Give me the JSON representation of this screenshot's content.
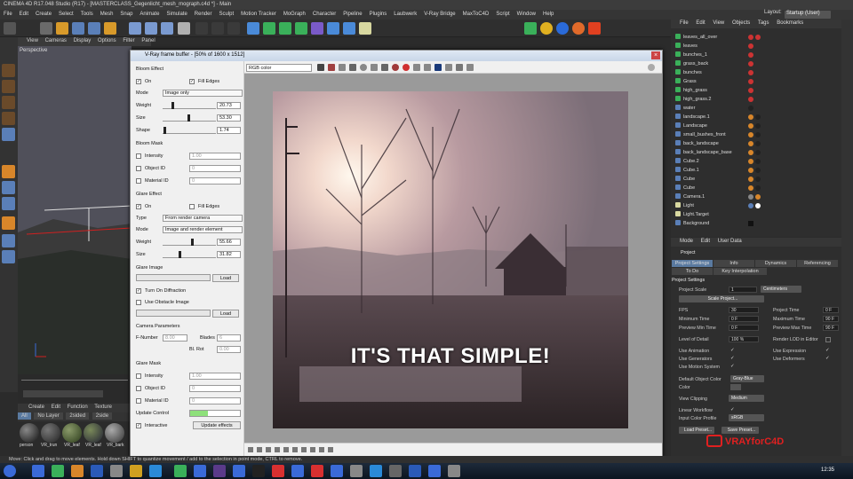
{
  "titlebar": "CINEMA 4D R17.048 Studio (R17) - [MASTERCLASS_Gegenlicht_mesh_mograph.c4d *] - Main",
  "menu": [
    "File",
    "Edit",
    "Create",
    "Select",
    "Tools",
    "Mesh",
    "Snap",
    "Animate",
    "Simulate",
    "Render",
    "Sculpt",
    "Motion Tracker",
    "MoGraph",
    "Character",
    "Pipeline",
    "Plugins",
    "Laubwerk",
    "V-Ray Bridge",
    "MaxToC4D",
    "Script",
    "Window",
    "Help"
  ],
  "layout": {
    "label": "Layout:",
    "value": "Startup (User)"
  },
  "viewport": {
    "menu": [
      "View",
      "Cameras",
      "Display",
      "Options",
      "Filter",
      "Panel"
    ],
    "label": "Perspective"
  },
  "material_manager": {
    "menu": [
      "Create",
      "Edit",
      "Function",
      "Texture"
    ],
    "tabs": [
      "All",
      "No Layer",
      "2sided",
      "2side"
    ],
    "materials": [
      "person",
      "VR_trun",
      "VR_leaf",
      "VR_leaf",
      "VR_bark"
    ]
  },
  "vfb": {
    "title": "V-Ray frame buffer - [50% of 1600 x 1512]",
    "channel": "RGB color",
    "bloom_effect": {
      "header": "Bloom Effect",
      "on": "On",
      "fill_edges": "Fill Edges",
      "mode_label": "Mode",
      "mode": "Image only",
      "weight_label": "Weight",
      "weight": "20.73",
      "size_label": "Size",
      "size": "53.30",
      "shape_label": "Shape",
      "shape": "1.74"
    },
    "bloom_mask": {
      "header": "Bloom Mask",
      "intensity": "Intensity",
      "intensity_val": "1.00",
      "object_id": "Object ID",
      "object_id_val": "0",
      "material_id": "Material ID",
      "material_id_val": "0"
    },
    "glare_effect": {
      "header": "Glare Effect",
      "on": "On",
      "fill_edges": "Fill Edges",
      "type_label": "Type",
      "type": "From render camera",
      "mode_label": "Mode",
      "mode": "Image and render element",
      "weight_label": "Weight",
      "weight": "55.66",
      "size_label": "Size",
      "size": "31.82"
    },
    "glare_image": {
      "header": "Glare Image",
      "load": "Load",
      "diffraction": "Turn On Diffraction",
      "obstacle": "Use Obstacle Image",
      "load2": "Load"
    },
    "camera": {
      "header": "Camera Parameters",
      "fnumber": "F-Number",
      "fnumber_val": "8.00",
      "blades": "Blades",
      "blades_val": "6",
      "blrot": "Bl. Rot",
      "blrot_val": "0.00"
    },
    "glare_mask": {
      "header": "Glare Mask",
      "intensity": "Intensity",
      "intensity_val": "1.00",
      "object_id": "Object ID",
      "object_id_val": "0",
      "material_id": "Material ID",
      "material_id_val": "0"
    },
    "update_control": "Update Control",
    "interactive": "Interactive",
    "update_effects": "Update effects",
    "caption": "IT'S THAT SIMPLE!"
  },
  "object_manager": {
    "menu": [
      "File",
      "Edit",
      "View",
      "Objects",
      "Tags",
      "Bookmarks"
    ],
    "objects": [
      "leaves_all_over",
      "leaves",
      "bunches_1",
      "grass_back",
      "bunches",
      "Grass",
      "high_grass",
      "high_grass.2",
      "water",
      "landscape.1",
      "Landscape",
      "small_bushes_front",
      "back_landscape",
      "back_landscape_base",
      "Cube.2",
      "Cube.1",
      "Cube",
      "Cube",
      "Camera.1",
      "Light",
      "Light.Target",
      "Background"
    ]
  },
  "attributes": {
    "menu": [
      "Mode",
      "Edit",
      "User Data"
    ],
    "object": "Project",
    "tabs": [
      "Project Settings",
      "Info",
      "Dynamics",
      "Referencing",
      "To Do",
      "Key Interpolation"
    ],
    "section": "Project Settings",
    "project_scale": "Project Scale",
    "project_scale_val": "1",
    "project_scale_unit": "Centimeters",
    "scale_project": "Scale Project...",
    "fps": "FPS",
    "fps_val": "30",
    "project_time": "Project Time",
    "project_time_val": "0 F",
    "min_time": "Minimum Time",
    "min_time_val": "0 F",
    "max_time": "Maximum Time",
    "max_time_val": "90 F",
    "prev_min": "Preview Min Time",
    "prev_min_val": "0 F",
    "prev_max": "Preview Max Time",
    "prev_max_val": "90 F",
    "lod": "Level of Detail",
    "lod_val": "100 %",
    "render_lod": "Render LOD in Editor",
    "use_anim": "Use Animation",
    "use_expr": "Use Expression",
    "use_gen": "Use Generators",
    "use_deform": "Use Deformers",
    "use_motion": "Use Motion System",
    "default_color": "Default Object Color",
    "default_color_val": "Gray-Blue",
    "color": "Color",
    "view_clipping": "View Clipping",
    "view_clipping_val": "Medium",
    "linear_workflow": "Linear Workflow",
    "input_color": "Input Color Profile",
    "input_color_val": "sRGB",
    "load_preset": "Load Preset...",
    "save_preset": "Save Preset..."
  },
  "brand": "VRAYforC4D",
  "status": "Move: Click and drag to move elements. Hold down SHIFT to quantize movement / add to the selection in point mode, CTRL to remove.",
  "clock": "12:35",
  "colors": {
    "accent": "#e02020",
    "selected_tab": "#5a7aa0"
  }
}
